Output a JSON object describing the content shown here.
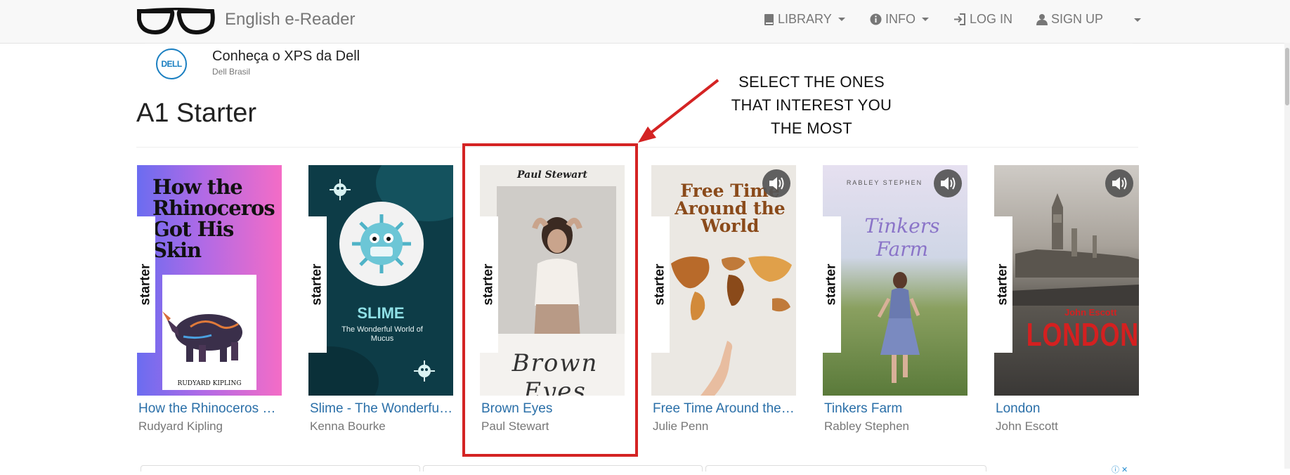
{
  "navbar": {
    "brand": "English e-Reader",
    "items": [
      {
        "label": "LIBRARY",
        "icon": "book-icon",
        "dropdown": true
      },
      {
        "label": "INFO",
        "icon": "info-icon",
        "dropdown": true
      },
      {
        "label": "LOG IN",
        "icon": "login-icon",
        "dropdown": false
      },
      {
        "label": "SIGN UP",
        "icon": "user-icon",
        "dropdown": false
      }
    ]
  },
  "ad": {
    "logo": "DELL",
    "title": "Conheça o XPS da Dell",
    "subtitle": "Dell Brasil"
  },
  "section": {
    "title": "A1 Starter"
  },
  "annotation": {
    "lines": [
      "SELECT THE ONES",
      "THAT INTEREST YOU",
      "THE MOST"
    ],
    "color": "#d42323"
  },
  "level_badge": "starter",
  "books": [
    {
      "title": "How the Rhinoceros Got His Skin",
      "author": "Rudyard Kipling",
      "cover_heading": "How the Rhinoceros Got His Skin",
      "cover_footer": "RUDYARD KIPLING",
      "audio": false
    },
    {
      "title": "Slime - The Wonderful World of Mucus",
      "author": "Kenna Bourke",
      "cover_heading": "SLIME",
      "cover_sub": "The Wonderful World of Mucus",
      "audio": false
    },
    {
      "title": "Brown Eyes",
      "author": "Paul Stewart",
      "cover_top": "Paul Stewart",
      "cover_heading": "Brown Eyes",
      "audio": false,
      "highlighted": true
    },
    {
      "title": "Free Time Around the World",
      "author": "Julie Penn",
      "cover_heading": "Free Time Around the World",
      "audio": true
    },
    {
      "title": "Tinkers Farm",
      "author": "Rabley Stephen",
      "cover_top": "RABLEY STEPHEN",
      "cover_heading": "Tinkers Farm",
      "audio": true
    },
    {
      "title": "London",
      "author": "John Escott",
      "cover_top": "John Escott",
      "cover_heading": "LONDON",
      "audio": true
    }
  ]
}
